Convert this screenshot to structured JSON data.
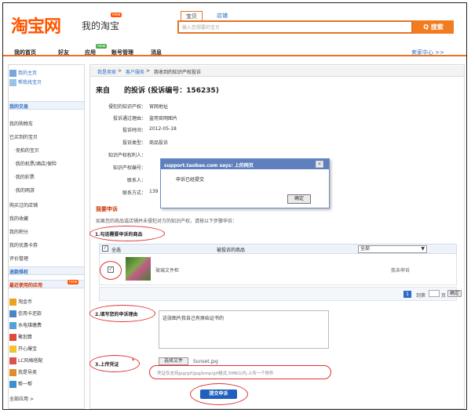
{
  "header": {
    "logo": "淘宝网",
    "subtitle": "我的淘宝",
    "badge": "new",
    "search_tabs": [
      "宝贝",
      "店铺"
    ],
    "search_placeholder": "输入您想要的宝贝",
    "search_button": "Q 搜索"
  },
  "nav": {
    "items": [
      "我的首页",
      "好友",
      "应用",
      "账号管理",
      "消息"
    ],
    "right_link": "卖家中心 >>",
    "app_badge": "new"
  },
  "sidebar": {
    "top_links": [
      "我的主页",
      "帮我找宝贝"
    ],
    "trade_section": "我的交易",
    "trade_items": [
      "我的购物车",
      "已买到的宝贝",
      "·竞拍的宝贝",
      "·我的机票/酒店/保险",
      "·我的彩票",
      "·我的网游",
      "购买过的店铺",
      "我的收藏",
      "我的积分",
      "我的优惠卡券",
      "评价管理"
    ],
    "rights_section": "退款维权",
    "apps_section": "最近使用的应用",
    "apps_badge": "new",
    "apps": [
      "淘金币",
      "信用卡还款",
      "水电煤缴费",
      "聚划算",
      "开心爆宝",
      "LC风格搭配",
      "我是导卖",
      "帮一帮"
    ],
    "all_apps": "全部应用 >"
  },
  "breadcrumb": {
    "items": [
      "我是卖家",
      "客户服务",
      "我收到的知识产权投诉"
    ],
    "seps": [
      " > ",
      " > "
    ]
  },
  "page": {
    "title": "来自　　的投诉 (投诉编号：156235)",
    "fields": [
      {
        "label": "侵犯的知识产权：",
        "value": "官网地址"
      },
      {
        "label": "投诉通过理由：",
        "value": "盗用官网图片"
      },
      {
        "label": "投诉时间：",
        "value": "2012-05-18"
      },
      {
        "label": "投诉类型：",
        "value": "商品投诉"
      },
      {
        "label": "知识产权权利人：",
        "value": ""
      },
      {
        "label": "知识产权编号：",
        "value": ""
      },
      {
        "label": "联系人：",
        "value": ""
      },
      {
        "label": "联系方式：",
        "value": "139"
      }
    ],
    "appeal_title": "我要申诉",
    "appeal_hint": "如果您的商品或店铺并未侵犯对方的知识产权，请按以下步骤申诉：",
    "step1": "1.勾选需要申诉的商品",
    "select_all": "全选",
    "col_goods": "被投诉的商品",
    "filter_value": "全部",
    "item_name": "玻璃文件柜",
    "item_status": "我未申诉",
    "pager": {
      "current": "1",
      "goto": "到第",
      "page_suffix": "页",
      "confirm": "确定"
    },
    "step2": "2.填写您的申诉理由",
    "reason_text": "这张图片我自己有原始证书的",
    "step3": "3.上传凭证",
    "step3_star": "*",
    "file_button": "选择文件",
    "file_name": "Sunset.jpg",
    "file_hint": "凭证仅支持jpg/gif/jpg/bmp/gif格式,5MB以内,上传一个附件",
    "submit": "提交申诉"
  },
  "dialog": {
    "title": "support.taobao.com says: 上的网页",
    "close": "×",
    "message": "申诉已经提交",
    "ok": "确定"
  },
  "colors": {
    "brand": "#ff5500",
    "link": "#2b6cc4",
    "accent": "#e67326"
  }
}
